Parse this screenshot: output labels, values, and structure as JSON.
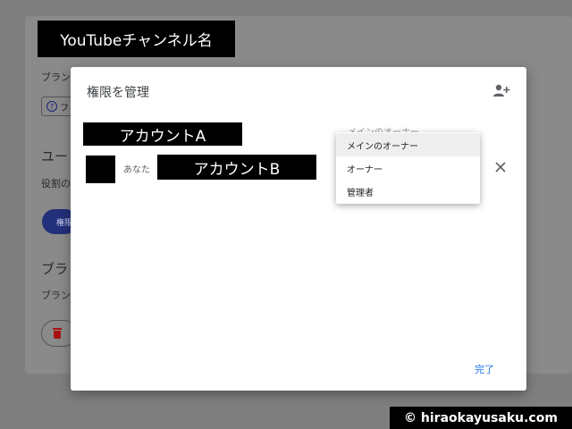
{
  "background": {
    "channel_name": "YouTubeチャンネル名",
    "brand_text_1": "ブラン",
    "chip_text": "フ",
    "section_user": "ユー",
    "role_text": "役割の",
    "perm_button": "権限",
    "section_brand": "ブラ",
    "brand_text_2": "ブラン"
  },
  "dialog": {
    "title": "権限を管理",
    "account_a": "アカウントA",
    "owner_ghost": "メインのオーナー",
    "you_label": "あなた",
    "account_b": "アカウントB",
    "done_label": "完了"
  },
  "role_menu": {
    "options": [
      "メインのオーナー",
      "オーナー",
      "管理者"
    ],
    "selected": "メインのオーナー"
  },
  "watermark": "© hiraokayusaku.com",
  "colors": {
    "accent": "#1a73e8",
    "overlay": "#7f7f7f",
    "mask": "#000000"
  }
}
